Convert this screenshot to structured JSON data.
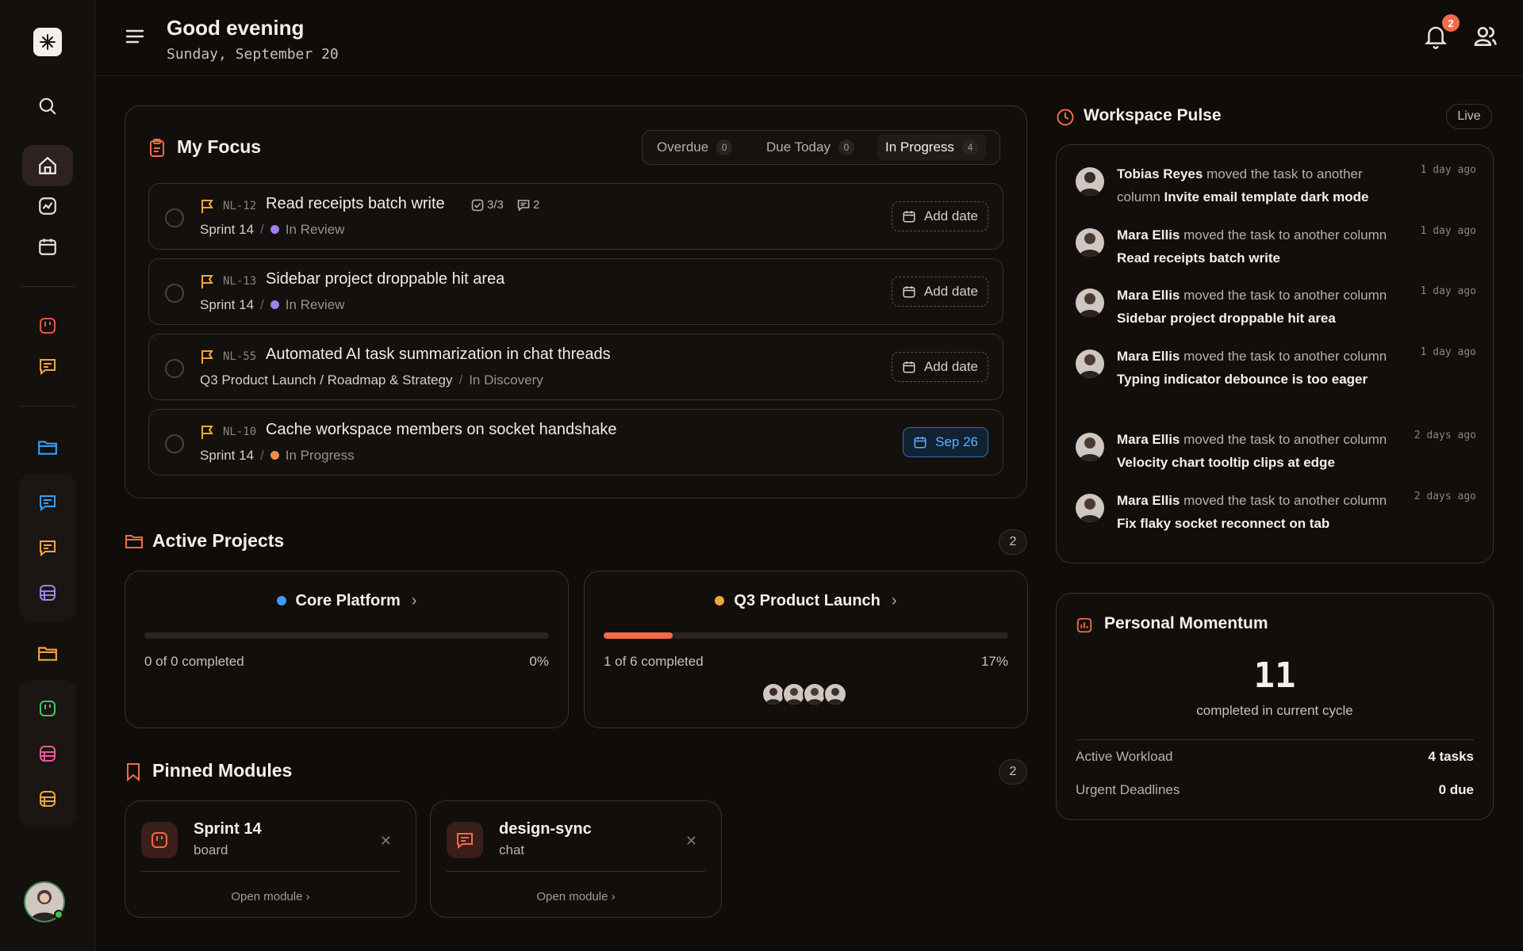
{
  "header": {
    "greeting": "Good evening",
    "date": "Sunday, September 20",
    "notification_count": "2"
  },
  "focus": {
    "title": "My Focus",
    "tabs": [
      {
        "label": "Overdue",
        "count": "0"
      },
      {
        "label": "Due Today",
        "count": "0"
      },
      {
        "label": "In Progress",
        "count": "4"
      }
    ],
    "active_tab": "In Progress",
    "tasks": [
      {
        "id": "NL-12",
        "title": "Read receipts batch write",
        "checklist": "3/3",
        "comments": "2",
        "location": "Sprint 14",
        "status": "In Review",
        "status_color": "#a27ff0",
        "date": "Add date"
      },
      {
        "id": "NL-13",
        "title": "Sidebar project droppable hit area",
        "location": "Sprint 14",
        "status": "In Review",
        "status_color": "#a27ff0",
        "date": "Add date"
      },
      {
        "id": "NL-55",
        "title": "Automated AI task summarization in chat threads",
        "location": "Q3 Product Launch / Roadmap & Strategy",
        "status": "In Discovery",
        "date": "Add date"
      },
      {
        "id": "NL-10",
        "title": "Cache workspace members on socket handshake",
        "location": "Sprint 14",
        "status": "In Progress",
        "status_color": "#f28c4a",
        "date": "Sep 26"
      }
    ]
  },
  "projects": {
    "title": "Active Projects",
    "count": "2",
    "items": [
      {
        "name": "Core Platform",
        "color": "#3d9bf0",
        "progress_pct": 0,
        "completed_text": "0 of 0 completed",
        "percent_text": "0%"
      },
      {
        "name": "Q3 Product Launch",
        "color": "#f0a63d",
        "progress_pct": 17,
        "completed_text": "1 of 6 completed",
        "percent_text": "17%"
      }
    ]
  },
  "modules": {
    "title": "Pinned Modules",
    "count": "2",
    "open_label": "Open module",
    "items": [
      {
        "name": "Sprint 14",
        "type": "board",
        "icon": "board-icon"
      },
      {
        "name": "design-sync",
        "type": "chat",
        "icon": "chat-icon"
      }
    ]
  },
  "pulse": {
    "title": "Workspace Pulse",
    "live_label": "Live",
    "activities": [
      {
        "user": "Tobias Reyes",
        "action": "moved the task to another column",
        "task": "Invite email template dark mode",
        "time": "1 day ago"
      },
      {
        "user": "Mara Ellis",
        "action": "moved the task to another column",
        "task": "Read receipts batch write",
        "time": "1 day ago"
      },
      {
        "user": "Mara Ellis",
        "action": "moved the task to another column",
        "task": "Sidebar project droppable hit area",
        "time": "1 day ago"
      },
      {
        "user": "Mara Ellis",
        "action": "moved the task to another column",
        "task": "Typing indicator debounce is too eager",
        "time": "1 day ago"
      },
      {
        "user": "Mara Ellis",
        "action": "moved the task to another column",
        "task": "Velocity chart tooltip clips at edge",
        "time": "2 days ago"
      },
      {
        "user": "Mara Ellis",
        "action": "moved the task to another column",
        "task": "Fix flaky socket reconnect on tab",
        "time": "2 days ago"
      }
    ]
  },
  "momentum": {
    "title": "Personal Momentum",
    "completed": "11",
    "completed_label": "completed in current cycle",
    "rows": [
      {
        "label": "Active Workload",
        "value": "4 tasks"
      },
      {
        "label": "Urgent Deadlines",
        "value": "0 due"
      }
    ]
  },
  "colors": {
    "accent": "#f26b4a",
    "blue": "#3d9bf0",
    "orange": "#f0a63d"
  }
}
